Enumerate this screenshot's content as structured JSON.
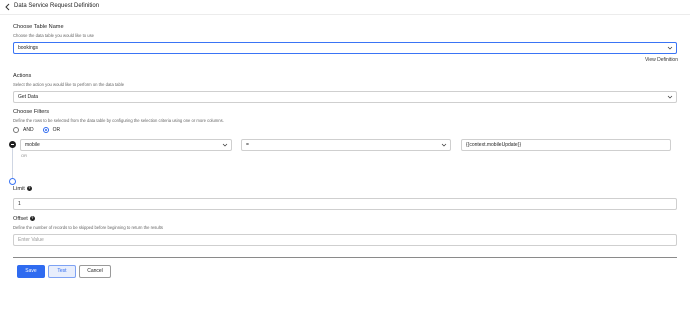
{
  "header": {
    "title": "Data Service Request Definition"
  },
  "table_name": {
    "label": "Choose Table Name",
    "description": "Choose the data table you would like to use",
    "value": "bookings",
    "view_definition": "View Definition"
  },
  "actions": {
    "label": "Actions",
    "description": "Select the action you would like to perform on the data table",
    "value": "Get Data"
  },
  "filters": {
    "label": "Choose Filters",
    "description": "Define the rows to be selected from the data table by configuring the selection criteria using one or more columns.",
    "options": [
      "AND",
      "OR"
    ],
    "selected": "OR",
    "or_label": "OR",
    "row": {
      "column": "mobile",
      "operator": "=",
      "value": "{{context.mobileUpdate}}"
    }
  },
  "limit": {
    "label": "Limit",
    "value": "1"
  },
  "offset": {
    "label": "Offset",
    "description": "Define the number of records to be skipped before beginning to return the results",
    "placeholder": "Enter Value"
  },
  "buttons": {
    "save": "Save",
    "test": "Test",
    "cancel": "Cancel"
  },
  "colors": {
    "accent": "#2f6bf0",
    "focus_border": "#3a74f5"
  }
}
